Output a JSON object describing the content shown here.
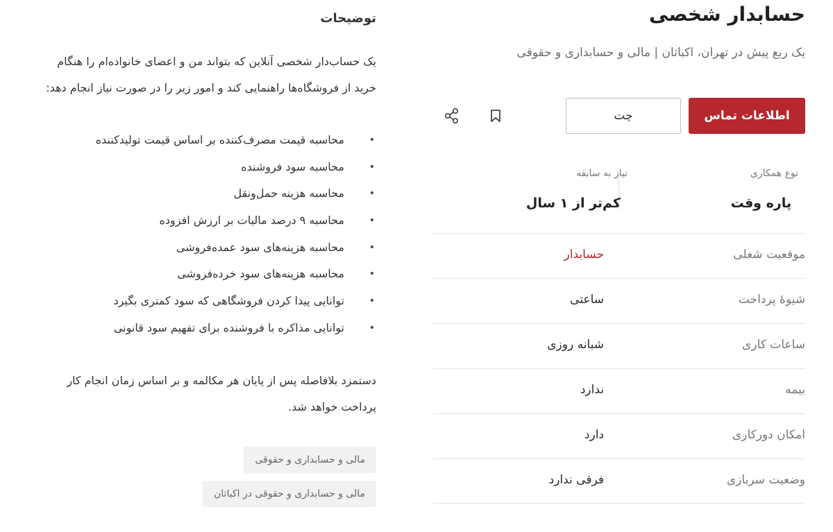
{
  "job": {
    "title": "حسابدار شخصی",
    "subtitle": "یک ربع پیش در تهران، اکباتان | مالی و حسابداری و حقوقی",
    "contact_label": "اطلاعات تماس",
    "chat_label": "چت"
  },
  "summary": {
    "collab_label": "نوع همکاری",
    "collab_value": "پاره وقت",
    "experience_label": "نیاز به سابقه",
    "experience_value": "کم‌تر از ۱ سال"
  },
  "details": [
    {
      "label": "موقعیت شغلی",
      "value": "حسابدار"
    },
    {
      "label": "شیوهٔ پرداخت",
      "value": "ساعتی"
    },
    {
      "label": "ساعات کاری",
      "value": "شبانه روزی"
    },
    {
      "label": "بیمه",
      "value": "ندارد"
    },
    {
      "label": "امکان دورکاری",
      "value": "دارد"
    },
    {
      "label": "وضعیت سربازی",
      "value": "فرقی ندارد"
    }
  ],
  "description": {
    "heading": "توضیحات",
    "intro": "یک حساب‌دار شخصی آنلاین که بتواند من و اعضای خانواده‌ام را هنگام خرید از فروشگاه‌ها راهنمایی کند و امور زیر را در صورت نیاز انجام دهد:",
    "bullets": [
      "محاسبه قیمت مصرف‌کننده بر اساس قیمت تولیدکننده",
      "محاسبه سود فروشنده",
      "محاسبه هزینه حمل‌ونقل",
      "محاسبه ۹ درصد مالیات بر ارزش افزوده",
      "محاسبه هزینه‌های سود عمده‌فروشی",
      "محاسبه هزینه‌های سود خرده‌فروشی",
      "توانایی پیدا کردن فروشگاهی که سود کمتری بگیرد",
      "توانایی مذاکره با فروشنده برای تفهیم سود قانونی"
    ],
    "outro": "دستمزد بلافاصله پس از پایان هر مکالمه و بر اساس زمان انجام کار پرداخت خواهد شد."
  },
  "tags": [
    "مالی و حسابداری و حقوقی",
    "مالی و حسابداری و حقوقی در اکباتان"
  ],
  "colors": {
    "accent": "#b6272e",
    "muted_text": "#777777",
    "tag_bg": "#f1f1f1"
  },
  "icons": {
    "bookmark": "bookmark-icon",
    "share": "share-icon"
  }
}
